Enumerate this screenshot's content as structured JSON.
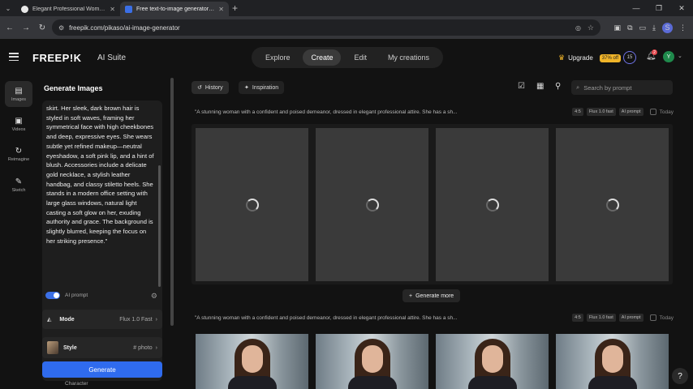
{
  "browser": {
    "tabs": [
      {
        "title": "Elegant Professional Woman In",
        "active": false
      },
      {
        "title": "Free text-to-image generator | F",
        "active": true
      }
    ],
    "url": "freepik.com/pikaso/ai-image-generator",
    "profile_initial": "S"
  },
  "header": {
    "logo": "FREEP!K",
    "suite": "AI Suite",
    "nav": [
      "Explore",
      "Create",
      "Edit",
      "My creations"
    ],
    "selected_nav": "Create",
    "upgrade_label": "Upgrade",
    "discount": "37% off",
    "credits": "15",
    "notifications": "2",
    "avatar_initial": "Y"
  },
  "rail": [
    {
      "label": "Images",
      "icon": "image-icon"
    },
    {
      "label": "Videos",
      "icon": "video-icon"
    },
    {
      "label": "Reimagine",
      "icon": "reimagine-icon"
    },
    {
      "label": "Sketch",
      "icon": "sketch-icon"
    }
  ],
  "panel": {
    "title": "Generate Images",
    "prompt_text": "skirt. Her sleek, dark brown hair is styled in soft waves, framing her symmetrical face with high cheekbones and deep, expressive eyes. She wears subtle yet refined makeup—neutral eyeshadow, a soft pink lip, and a hint of blush. Accessories include a delicate gold necklace, a stylish leather handbag, and classy stiletto heels. She stands in a modern office setting with large glass windows, natural light casting a soft glow on her, exuding authority and grace. The background is slightly blurred, keeping the focus on her striking presence.\"",
    "ai_prompt_label": "AI prompt",
    "mode_label": "Mode",
    "mode_value": "Flux 1.0 Fast",
    "style_label": "Style",
    "style_value": "# photo",
    "generate_label": "Generate",
    "character_label": "Character"
  },
  "toolbar": {
    "history_label": "History",
    "inspiration_label": "Inspiration",
    "search_placeholder": "Search by prompt"
  },
  "batches": [
    {
      "prompt": "\"A stunning woman with a confident and poised demeanor, dressed in elegant professional attire. She has a sh...",
      "tags": [
        "4:5",
        "Flux 1.0 fast",
        "AI prompt"
      ],
      "date": "Today",
      "status": "loading",
      "generate_more_label": "Generate more"
    },
    {
      "prompt": "\"A stunning woman with a confident and poised demeanor, dressed in elegant professional attire. She has a sh...",
      "tags": [
        "4:5",
        "Flux 1.0 fast",
        "AI prompt"
      ],
      "date": "Today",
      "status": "done"
    }
  ],
  "help_label": "?"
}
